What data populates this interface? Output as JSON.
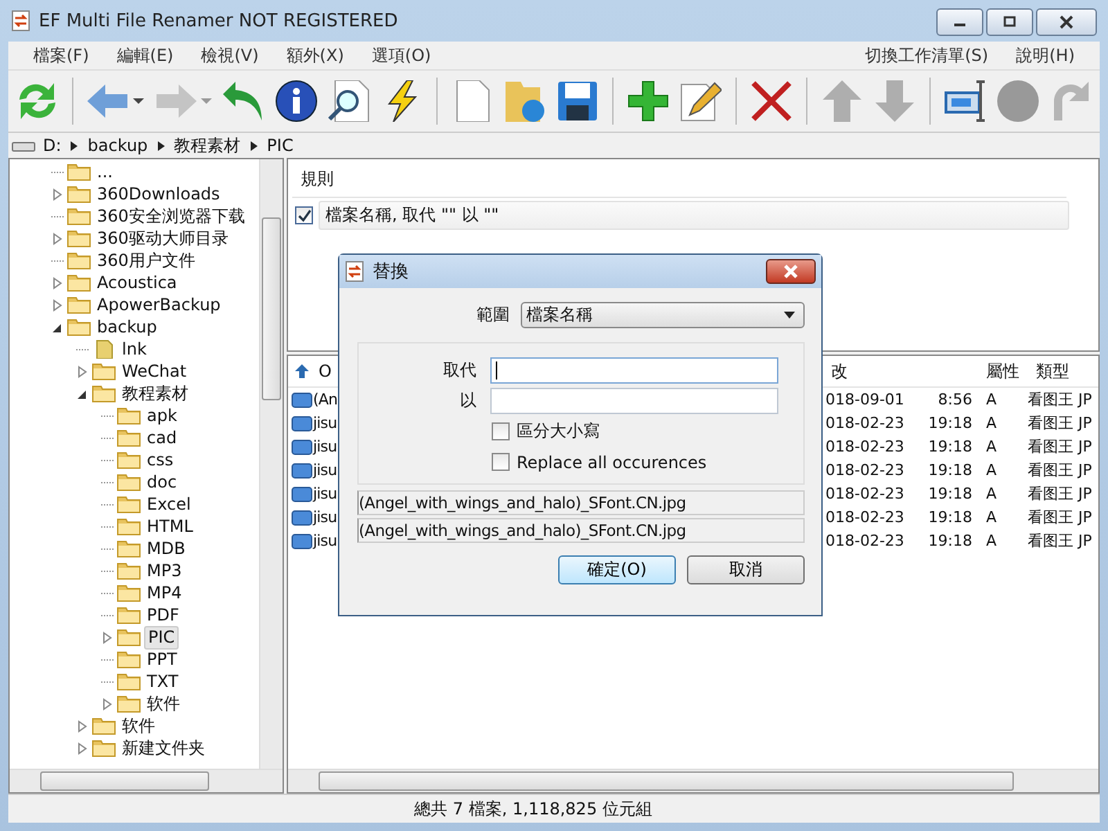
{
  "window": {
    "title": "EF Multi File Renamer NOT REGISTERED"
  },
  "menu": {
    "left": [
      "檔案(F)",
      "編輯(E)",
      "檢視(V)",
      "額外(X)",
      "選項(O)"
    ],
    "right": [
      "切換工作清單(S)",
      "說明(H)"
    ]
  },
  "toolbar": [
    [
      {
        "kind": "refresh",
        "disabled": false,
        "dropdown": false
      }
    ],
    [
      {
        "kind": "back",
        "disabled": false,
        "dropdown": true
      },
      {
        "kind": "forward",
        "disabled": true,
        "dropdown": true
      },
      {
        "kind": "undo",
        "disabled": false,
        "dropdown": false
      },
      {
        "kind": "info",
        "disabled": false,
        "dropdown": false
      },
      {
        "kind": "preview",
        "disabled": false,
        "dropdown": false
      },
      {
        "kind": "lightning",
        "disabled": false,
        "dropdown": false
      }
    ],
    [
      {
        "kind": "new",
        "disabled": false,
        "dropdown": false
      },
      {
        "kind": "open",
        "disabled": false,
        "dropdown": false
      },
      {
        "kind": "save",
        "disabled": false,
        "dropdown": false
      }
    ],
    [
      {
        "kind": "add",
        "disabled": false,
        "dropdown": false
      },
      {
        "kind": "edit",
        "disabled": false,
        "dropdown": false
      }
    ],
    [
      {
        "kind": "delete",
        "disabled": false,
        "dropdown": false
      }
    ],
    [
      {
        "kind": "up",
        "disabled": true,
        "dropdown": false
      },
      {
        "kind": "down",
        "disabled": true,
        "dropdown": false
      }
    ],
    [
      {
        "kind": "rename",
        "disabled": false,
        "dropdown": false
      },
      {
        "kind": "record",
        "disabled": true,
        "dropdown": false
      },
      {
        "kind": "redo",
        "disabled": true,
        "dropdown": false
      }
    ]
  ],
  "path": [
    "D:",
    "backup",
    "教程素材",
    "PIC"
  ],
  "tree": [
    {
      "label": "...",
      "kind": "folder",
      "expandable": false,
      "selected": false
    },
    {
      "label": "360Downloads",
      "kind": "folder",
      "expandable": true,
      "expanded": false,
      "selected": false
    },
    {
      "label": "360安全浏览器下载",
      "kind": "folder",
      "expandable": false,
      "selected": false
    },
    {
      "label": "360驱动大师目录",
      "kind": "folder",
      "expandable": true,
      "expanded": false,
      "selected": false
    },
    {
      "label": "360用户文件",
      "kind": "folder",
      "expandable": false,
      "selected": false
    },
    {
      "label": "Acoustica",
      "kind": "folder",
      "expandable": true,
      "expanded": false,
      "selected": false
    },
    {
      "label": "ApowerBackup",
      "kind": "folder",
      "expandable": true,
      "expanded": false,
      "selected": false
    },
    {
      "label": "backup",
      "kind": "folder",
      "expandable": true,
      "expanded": true,
      "selected": false,
      "children": [
        {
          "label": "lnk",
          "kind": "file",
          "expandable": false,
          "selected": false
        },
        {
          "label": "WeChat",
          "kind": "folder",
          "expandable": true,
          "expanded": false,
          "selected": false
        },
        {
          "label": "教程素材",
          "kind": "folder",
          "expandable": true,
          "expanded": true,
          "selected": false,
          "children": [
            {
              "label": "apk",
              "kind": "folder",
              "expandable": false,
              "selected": false
            },
            {
              "label": "cad",
              "kind": "folder",
              "expandable": false,
              "selected": false
            },
            {
              "label": "css",
              "kind": "folder",
              "expandable": false,
              "selected": false
            },
            {
              "label": "doc",
              "kind": "folder",
              "expandable": false,
              "selected": false
            },
            {
              "label": "Excel",
              "kind": "folder",
              "expandable": false,
              "selected": false
            },
            {
              "label": "HTML",
              "kind": "folder",
              "expandable": false,
              "selected": false
            },
            {
              "label": "MDB",
              "kind": "folder",
              "expandable": false,
              "selected": false
            },
            {
              "label": "MP3",
              "kind": "folder",
              "expandable": false,
              "selected": false
            },
            {
              "label": "MP4",
              "kind": "folder",
              "expandable": false,
              "selected": false
            },
            {
              "label": "PDF",
              "kind": "folder",
              "expandable": false,
              "selected": false
            },
            {
              "label": "PIC",
              "kind": "folder",
              "expandable": true,
              "expanded": false,
              "selected": true
            },
            {
              "label": "PPT",
              "kind": "folder",
              "expandable": false,
              "selected": false
            },
            {
              "label": "TXT",
              "kind": "folder",
              "expandable": false,
              "selected": false
            },
            {
              "label": "软件",
              "kind": "folder",
              "expandable": true,
              "expanded": false,
              "selected": false
            }
          ]
        },
        {
          "label": "软件",
          "kind": "folder",
          "expandable": true,
          "expanded": false,
          "selected": false
        },
        {
          "label": "新建文件夹",
          "kind": "folder",
          "expandable": true,
          "expanded": false,
          "selected": false
        }
      ]
    }
  ],
  "rules": {
    "header": "規則",
    "items": [
      {
        "checked": true,
        "text": "檔案名稱, 取代 \"\" 以 \"\""
      }
    ]
  },
  "file_list": {
    "columns": [
      "O",
      "改",
      "屬性",
      "類型"
    ],
    "rows": [
      {
        "name": "(An",
        "date": "018-09-01",
        "time": "8:56",
        "attr": "A",
        "type": "看图王 JP"
      },
      {
        "name": "jisu",
        "date": "018-02-23",
        "time": "19:18",
        "attr": "A",
        "type": "看图王 JP"
      },
      {
        "name": "jisu",
        "date": "018-02-23",
        "time": "19:18",
        "attr": "A",
        "type": "看图王 JP"
      },
      {
        "name": "jisu",
        "date": "018-02-23",
        "time": "19:18",
        "attr": "A",
        "type": "看图王 JP"
      },
      {
        "name": "jisu",
        "date": "018-02-23",
        "time": "19:18",
        "attr": "A",
        "type": "看图王 JP"
      },
      {
        "name": "jisu",
        "date": "018-02-23",
        "time": "19:18",
        "attr": "A",
        "type": "看图王 JP"
      },
      {
        "name": "jisu",
        "date": "018-02-23",
        "time": "19:18",
        "attr": "A",
        "type": "看图王 JP"
      }
    ]
  },
  "dialog": {
    "title": "替換",
    "scope_label": "範圍",
    "scope_value": "檔案名稱",
    "find_label": "取代",
    "find_focused": true,
    "replace_label": "以",
    "options": [
      {
        "label": "區分大小寫",
        "checked": false
      },
      {
        "label": "Replace all occurences",
        "checked": false
      }
    ],
    "preview": [
      "(Angel_with_wings_and_halo)_SFont.CN.jpg",
      "(Angel_with_wings_and_halo)_SFont.CN.jpg"
    ],
    "buttons": [
      {
        "label": "確定(O)",
        "default": true
      },
      {
        "label": "取消",
        "default": false
      }
    ]
  },
  "status_bar": "總共 7 檔案, 1,118,825 位元組"
}
